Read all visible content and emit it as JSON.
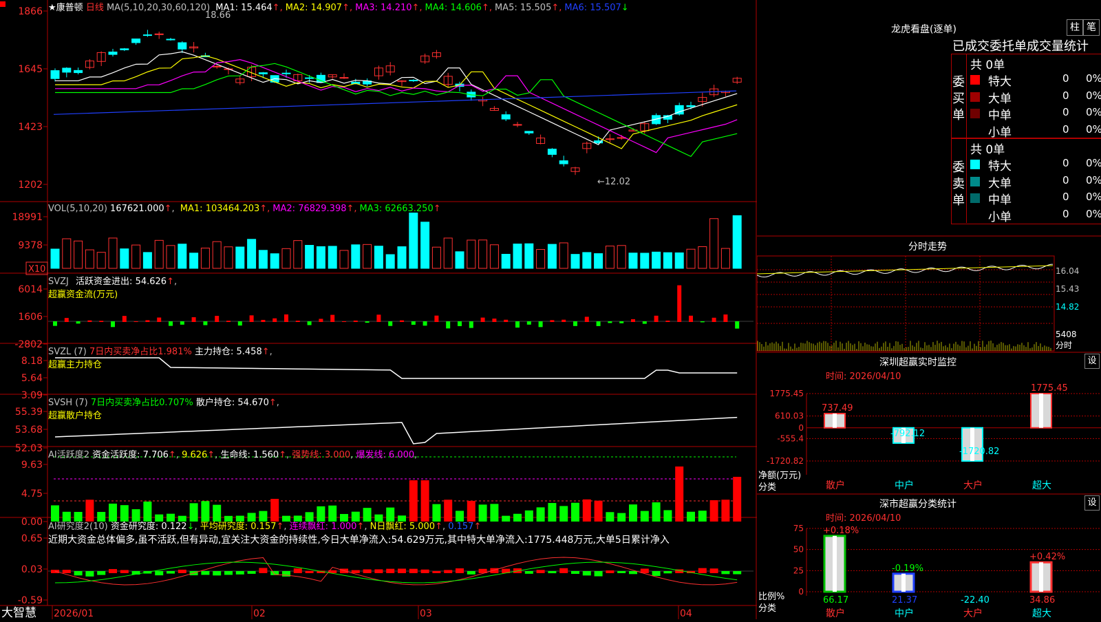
{
  "header": {
    "title": "康普顿",
    "period": "日线",
    "ma_label": "MA(5,10,20,30,60,120)",
    "ma": [
      {
        "label": "MA1:",
        "value": "15.464",
        "color": "#ffffff"
      },
      {
        "label": "MA2:",
        "value": "14.907",
        "color": "#ffff00"
      },
      {
        "label": "MA3:",
        "value": "14.210",
        "color": "#ff00ff"
      },
      {
        "label": "MA4:",
        "value": "14.606",
        "color": "#00ff00"
      },
      {
        "label": "MA5:",
        "value": "15.505",
        "color": "#c0c0c0"
      },
      {
        "label": "MA6:",
        "value": "15.507",
        "color": "#2040ff"
      }
    ],
    "high_mark": "18.66",
    "low_mark": "12.02"
  },
  "price_axis": [
    "1866",
    "1645",
    "1423",
    "1202"
  ],
  "vol": {
    "title": "VOL(5,10,20)",
    "value": "167621.000",
    "ma": [
      {
        "label": "MA1:",
        "value": "103464.203",
        "color": "#ffff00"
      },
      {
        "label": "MA2:",
        "value": "76829.398",
        "color": "#ff00ff"
      },
      {
        "label": "MA3:",
        "value": "62663.250",
        "color": "#00ff00"
      }
    ],
    "axis": [
      "18991",
      "9378"
    ],
    "unit": "X10"
  },
  "svzj": {
    "title": "SVZJ",
    "label": "活跃资金进出:",
    "value": "54.626",
    "sub": "超赢资金流(万元)",
    "axis": [
      "6014",
      "1606",
      "-2802"
    ]
  },
  "svzl": {
    "title": "SVZL (7)",
    "label1": "7日内买卖净占比1.981%",
    "label2": "主力持仓:",
    "value": "5.458",
    "sub": "超赢主力持仓",
    "axis": [
      "8.18",
      "5.64",
      "3.09"
    ]
  },
  "svsh": {
    "title": "SVSH (7)",
    "label1": "7日内买卖净占比0.707%",
    "label2": "散户持仓:",
    "value": "54.670",
    "sub": "超赢散户持仓",
    "axis": [
      "55.39",
      "53.68",
      "52.03"
    ]
  },
  "ai1": {
    "title": "AI活跃度2",
    "label": "资金活跃度:",
    "value": "7.706",
    "v2": "9.626",
    "life_label": "生命线:",
    "life": "1.560",
    "strong_label": "强势线:",
    "strong": "3.000",
    "burst_label": "爆发线:",
    "burst": "6.000",
    "axis": [
      "9.63",
      "4.75",
      "0.00"
    ]
  },
  "ai2": {
    "title": "AI研究度2(10)",
    "label": "资金研究度:",
    "value": "0.122",
    "avg_label": "平均研究度:",
    "avg": "0.157",
    "cont_label": "连续飘红:",
    "cont": "1.000",
    "n_label": "N日飘红:",
    "n": "5.000",
    "last": "0.157",
    "comment": "近期大资金总体偏多,虽不活跃,但有异动,宜关注大资金的持续性,今日大单净流入:54.629万元,其中特大单净流入:1775.448万元,大单5日累计净入",
    "axis": [
      "0.65",
      "0.03",
      "-0.59"
    ]
  },
  "xaxis": {
    "brand": "大智慧",
    "labels": [
      "2026/01",
      "02",
      "03",
      "04"
    ]
  },
  "right": {
    "lhb_title": "龙虎看盘(逐单)",
    "btn_col": "柱",
    "btn_pen": "笔",
    "table_title": "已成交委托单成交量统计",
    "buy_label": "委买单",
    "sell_label": "委卖单",
    "buy_total": "共 0单",
    "sell_total": "共 0单",
    "buy_rows": [
      {
        "name": "特大",
        "count": "0",
        "pct": "0%",
        "color": "#ff0000"
      },
      {
        "name": "大单",
        "count": "0",
        "pct": "0%",
        "color": "#a00000"
      },
      {
        "name": "中单",
        "count": "0",
        "pct": "0%",
        "color": "#700000"
      },
      {
        "name": "小单",
        "count": "0",
        "pct": "0%",
        "color": ""
      }
    ],
    "sell_rows": [
      {
        "name": "特大",
        "count": "0",
        "pct": "0%",
        "color": "#00ffff"
      },
      {
        "name": "大单",
        "count": "0",
        "pct": "0%",
        "color": "#008b8b"
      },
      {
        "name": "中单",
        "count": "0",
        "pct": "0%",
        "color": "#006a6a"
      },
      {
        "name": "小单",
        "count": "0",
        "pct": "0%",
        "color": ""
      }
    ],
    "fs_title": "分时走势",
    "fs_axis": [
      "16.04",
      "15.43",
      "14.82"
    ],
    "fs_vol": "5408",
    "fs_unit": "分时",
    "sz_title": "深圳超赢实时监控",
    "sz_btn": "设",
    "sz_time": "时间: 2026/04/10",
    "sz_axis": [
      "1775.45",
      "610.03",
      "0",
      "-555.4",
      "-1720.82"
    ],
    "sz_ylabel": "净额(万元)",
    "sz_xlabel": "分类",
    "sm_title": "深市超赢分类统计",
    "sm_btn": "设",
    "sm_time": "时间: 2026/04/10",
    "sm_axis": [
      "75",
      "50",
      "25",
      "0"
    ],
    "sm_ylabel": "比例%",
    "sm_xlabel": "分类"
  },
  "chart_data": [
    {
      "type": "bar",
      "title": "深圳超赢实时监控",
      "ylabel": "净额(万元)",
      "categories": [
        "散户",
        "中户",
        "大户",
        "超大"
      ],
      "values": [
        737.49,
        -792.12,
        -1720.82,
        1775.45
      ],
      "ylim": [
        -1720.82,
        1775.45
      ]
    },
    {
      "type": "bar",
      "title": "深市超赢分类统计",
      "ylabel": "比例%",
      "categories": [
        "散户",
        "中户",
        "大户",
        "超大"
      ],
      "values": [
        66.17,
        21.37,
        -22.4,
        34.86
      ],
      "changes": [
        "+0.18%",
        "-0.19%",
        "",
        "+0.42%"
      ],
      "ylim": [
        0,
        75
      ]
    }
  ]
}
